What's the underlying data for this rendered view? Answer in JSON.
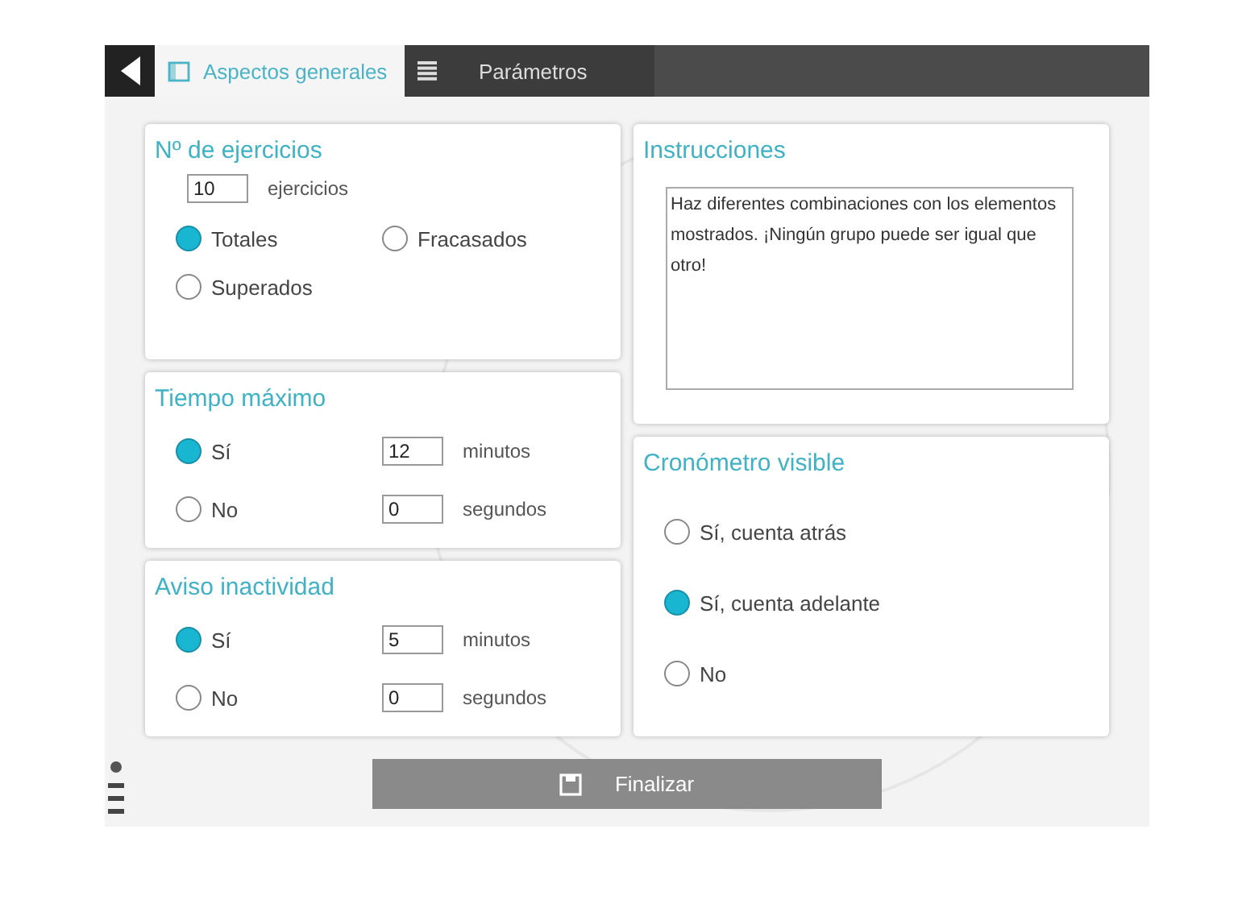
{
  "tabs": [
    {
      "label": "Aspectos generales",
      "selected": true
    },
    {
      "label": "Parámetros",
      "selected": false
    }
  ],
  "ejercicios": {
    "title": "Nº de ejercicios",
    "value": "10",
    "unit": "ejercicios",
    "options": [
      {
        "label": "Totales",
        "selected": true
      },
      {
        "label": "Fracasados",
        "selected": false
      },
      {
        "label": "Superados",
        "selected": false
      }
    ]
  },
  "timers": [
    {
      "title": "Tiempo máximo",
      "rows": [
        {
          "label": "Sí",
          "selected": true,
          "value": "12",
          "unit": "minutos"
        },
        {
          "label": "No",
          "selected": false,
          "value": "0",
          "unit": "segundos"
        }
      ]
    },
    {
      "title": "Aviso inactividad",
      "rows": [
        {
          "label": "Sí",
          "selected": true,
          "value": "5",
          "unit": "minutos"
        },
        {
          "label": "No",
          "selected": false,
          "value": "0",
          "unit": "segundos"
        }
      ]
    }
  ],
  "instructions": {
    "title": "Instrucciones",
    "text": "Haz diferentes combinaciones con los elementos mostrados. ¡Ningún grupo puede ser igual que otro!"
  },
  "chrono": {
    "title": "Cronómetro visible",
    "options": [
      {
        "label": "Sí, cuenta atrás",
        "selected": false
      },
      {
        "label": "Sí, cuenta adelante",
        "selected": true
      },
      {
        "label": "No",
        "selected": false
      }
    ]
  },
  "finish_button": "Finalizar"
}
